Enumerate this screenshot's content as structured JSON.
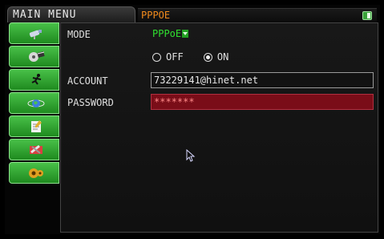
{
  "header": {
    "main_menu_label": "MAIN MENU",
    "page_title": "PPPOE"
  },
  "sidebar": {
    "items": [
      {
        "icon": "camera-icon"
      },
      {
        "icon": "film-icon"
      },
      {
        "icon": "running-man-icon"
      },
      {
        "icon": "network-globe-icon"
      },
      {
        "icon": "document-icon"
      },
      {
        "icon": "tools-icon"
      },
      {
        "icon": "speaker-icon"
      }
    ]
  },
  "form": {
    "mode_label": "MODE",
    "mode_value": "PPPoE",
    "off_label": "OFF",
    "on_label": "ON",
    "selected": "ON",
    "account_label": "ACCOUNT",
    "account_value": "73229141@hinet.net",
    "password_label": "PASSWORD",
    "password_value": "*******"
  },
  "colors": {
    "accent_green": "#2faa2f",
    "title_orange": "#f08a1c",
    "active_field": "#7a0d18"
  }
}
